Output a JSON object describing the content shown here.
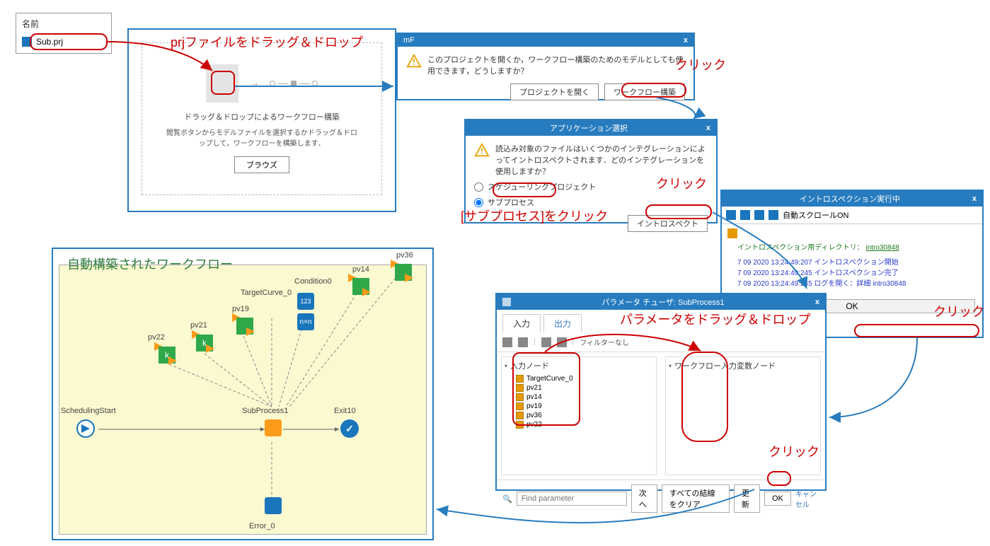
{
  "file_list": {
    "header": "名前",
    "file_name": "Sub.prj"
  },
  "annotations": {
    "drag_drop_file": "prjファイルをドラッグ＆ドロップ",
    "click1": "クリック",
    "subprocess_click": "[サブプロセス]をクリック",
    "click2": "クリック",
    "click3": "クリック",
    "drag_drop_param": "パラメータをドラッグ＆ドロップ",
    "click4": "クリック",
    "auto_built": "自動構築されたワークフロー"
  },
  "dropzone": {
    "title": "ドラッグ＆ドロップによるワークフロー構築",
    "subtitle": "閲覧ボタンからモデルファイルを選択するかドラッグ＆ドロップして，ワークフローを構築します．",
    "browse": "ブラウズ"
  },
  "dialog1": {
    "title_app": "mF",
    "message": "このプロジェクトを開くか，ワークフロー構築のためのモデルとしても使用できます，どうしますか？",
    "open_project": "プロジェクトを開く",
    "build_workflow": "ワークフロー構築",
    "close": "x"
  },
  "dialog2": {
    "title": "アプリケーション選択",
    "message": "読込み対象のファイルはいくつかのインテグレーションによってイントロスペクトされます．どのインテグレーションを使用しますか？",
    "opt_scheduling": "スケジューリングプロジェクト",
    "opt_subprocess": "サブプロセス",
    "introspect": "イントロスペクト",
    "close": "x"
  },
  "dialog3": {
    "title": "イントロスペクション実行中",
    "autoscroll": "自動スクロールON",
    "dir_label": "イントロスペクション用ディレクトリ：",
    "dir_link": "intro30848",
    "log": [
      "7 09 2020 13:24:49:207  イントロスペクション開始",
      "7 09 2020 13:24:49:245  イントロスペクション完了",
      "7 09 2020 13:24:49:245  ログを開く：詳細 intro30848"
    ],
    "ok": "OK",
    "close": "x"
  },
  "param": {
    "title": "パラメータ チューザ: SubProcess1",
    "tab_in": "入力",
    "tab_out": "出力",
    "filter": "フィルターなし",
    "left_hdr": "入力ノード",
    "right_hdr": "ワークフロー入力変数ノード",
    "leaves": [
      "TargetCurve_0",
      "pv21",
      "pv14",
      "pv19",
      "pv36",
      "pv22"
    ],
    "find_placeholder": "Find parameter",
    "next": "次へ",
    "clear": "すべての結線をクリア",
    "update": "更新",
    "ok": "OK",
    "cancel": "キャンセル",
    "close": "x"
  },
  "workflow": {
    "labels": {
      "pv22": "pv22",
      "pv21": "pv21",
      "pv19": "pv19",
      "target": "TargetCurve_0",
      "cond": "Condition0",
      "pv14": "pv14",
      "pv36": "pv36",
      "start": "SchedulingStart",
      "sp": "SubProcess1",
      "exit": "Exit10",
      "err": "Error_0"
    }
  }
}
